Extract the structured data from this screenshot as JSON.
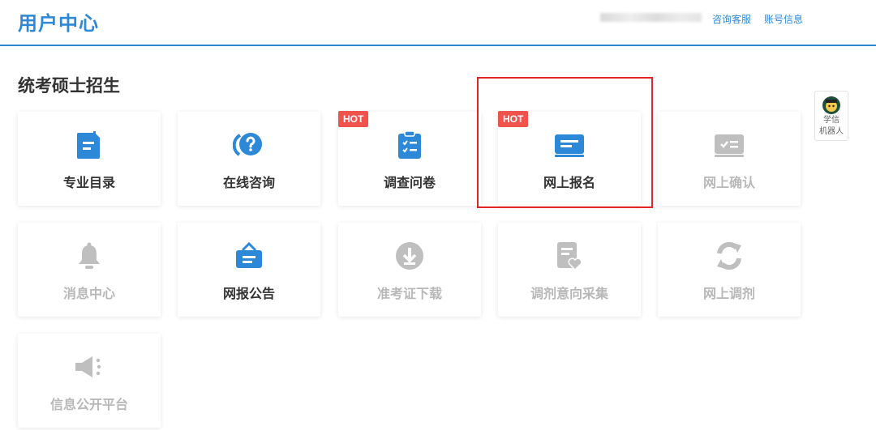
{
  "header": {
    "title": "用户中心",
    "links": {
      "consult": "咨询客服",
      "account": "账号信息"
    }
  },
  "section": {
    "title": "统考硕士招生"
  },
  "cards": [
    {
      "label": "专业目录",
      "icon": "catalog-document-icon",
      "enabled": true,
      "hot": false
    },
    {
      "label": "在线咨询",
      "icon": "question-chat-icon",
      "enabled": true,
      "hot": false
    },
    {
      "label": "调查问卷",
      "icon": "clipboard-checklist-icon",
      "enabled": true,
      "hot": true
    },
    {
      "label": "网上报名",
      "icon": "registration-card-icon",
      "enabled": true,
      "hot": true
    },
    {
      "label": "网上确认",
      "icon": "confirm-card-icon",
      "enabled": false,
      "hot": false
    },
    {
      "label": "消息中心",
      "icon": "bell-icon",
      "enabled": false,
      "hot": false
    },
    {
      "label": "网报公告",
      "icon": "announcement-box-icon",
      "enabled": true,
      "hot": false
    },
    {
      "label": "准考证下载",
      "icon": "download-circle-icon",
      "enabled": false,
      "hot": false
    },
    {
      "label": "调剂意向采集",
      "icon": "document-heart-icon",
      "enabled": false,
      "hot": false
    },
    {
      "label": "网上调剂",
      "icon": "refresh-cycle-icon",
      "enabled": false,
      "hot": false
    },
    {
      "label": "信息公开平台",
      "icon": "megaphone-icon",
      "enabled": false,
      "hot": false
    }
  ],
  "badges": {
    "hot": "HOT"
  },
  "robot": {
    "line1": "学信",
    "line2": "机器人"
  },
  "colors": {
    "accent": "#2d89d8",
    "hot_badge": "#f0524c",
    "highlight_border": "#e3252a",
    "disabled": "#bfbfbf"
  }
}
